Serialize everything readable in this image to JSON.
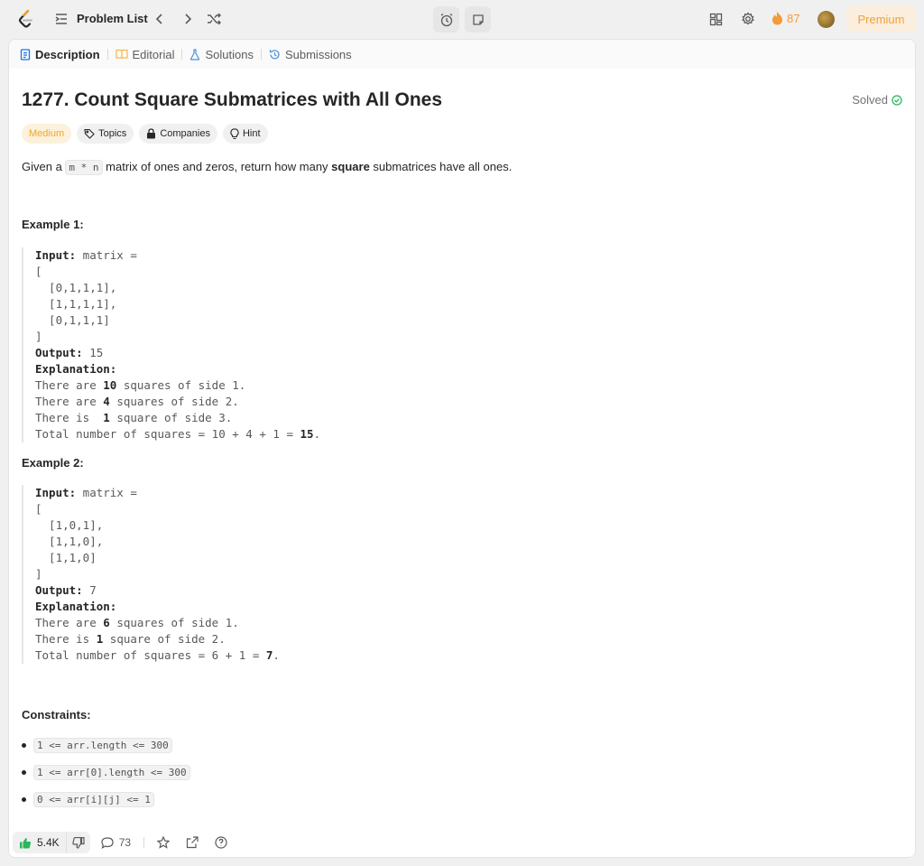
{
  "topbar": {
    "problem_list_label": "Problem List",
    "streak_count": "87",
    "premium_label": "Premium"
  },
  "tabs": [
    {
      "label": "Description",
      "active": true
    },
    {
      "label": "Editorial",
      "active": false
    },
    {
      "label": "Solutions",
      "active": false
    },
    {
      "label": "Submissions",
      "active": false
    }
  ],
  "problem": {
    "title": "1277. Count Square Submatrices with All Ones",
    "solved_label": "Solved",
    "difficulty": "Medium",
    "tags": [
      "Topics",
      "Companies",
      "Hint"
    ],
    "desc_before": "Given a ",
    "desc_code": "m * n",
    "desc_mid": " matrix of ones and zeros, return how many ",
    "desc_bold": "square",
    "desc_after": " submatrices have all ones."
  },
  "examples": [
    {
      "heading": "Example 1:",
      "input_label": "Input:",
      "input_value": " matrix =",
      "matrix_lines": [
        "[",
        "  [0,1,1,1],",
        "  [1,1,1,1],",
        "  [0,1,1,1]",
        "]"
      ],
      "output_label": "Output:",
      "output_value": " 15",
      "explanation_label": "Explanation:",
      "explanation": [
        {
          "pre": "There are ",
          "bold": "10",
          "post": " squares of side 1."
        },
        {
          "pre": "There are ",
          "bold": "4",
          "post": " squares of side 2."
        },
        {
          "pre": "There is  ",
          "bold": "1",
          "post": " square of side 3."
        },
        {
          "pre": "Total number of squares = 10 + 4 + 1 = ",
          "bold": "15",
          "post": "."
        }
      ]
    },
    {
      "heading": "Example 2:",
      "input_label": "Input:",
      "input_value": " matrix =",
      "matrix_lines": [
        "[",
        "  [1,0,1],",
        "  [1,1,0],",
        "  [1,1,0]",
        "]"
      ],
      "output_label": "Output:",
      "output_value": " 7",
      "explanation_label": "Explanation:",
      "explanation": [
        {
          "pre": "There are ",
          "bold": "6",
          "post": " squares of side 1."
        },
        {
          "pre": "There is ",
          "bold": "1",
          "post": " square of side 2."
        },
        {
          "pre": "Total number of squares = 6 + 1 = ",
          "bold": "7",
          "post": "."
        }
      ]
    }
  ],
  "constraints_heading": "Constraints:",
  "constraints": [
    "1 <= arr.length <= 300",
    "1 <= arr[0].length <= 300",
    "0 <= arr[i][j] <= 1"
  ],
  "footer": {
    "likes": "5.4K",
    "comments": "73"
  },
  "colors": {
    "accent_orange": "#f29b38",
    "medium": "#f5a623",
    "solved_green": "#2db55d",
    "like_green": "#2db55d",
    "active_tab_blue": "#1a73e8"
  }
}
